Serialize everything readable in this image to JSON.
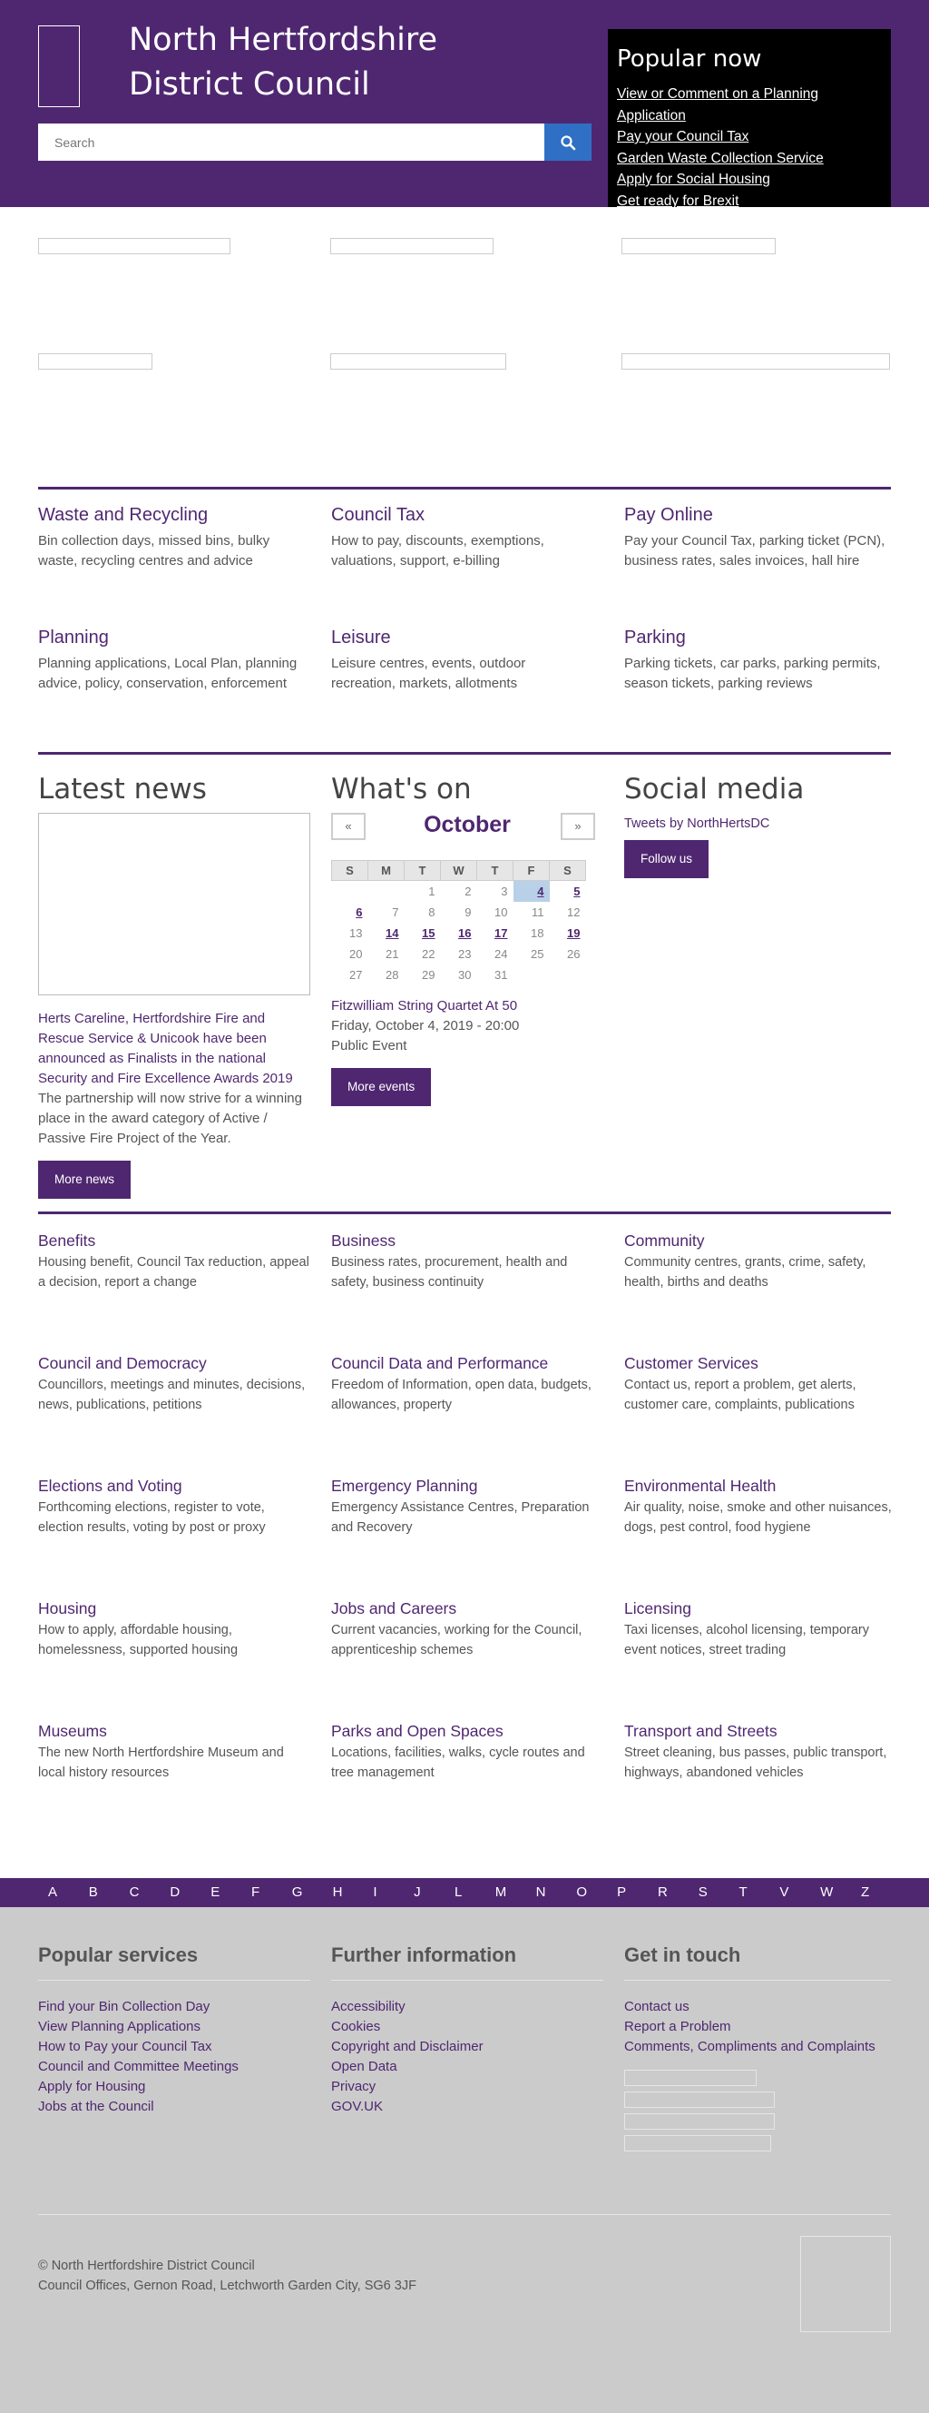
{
  "header": {
    "title_line1": "North Hertfordshire",
    "title_line2": "District Council",
    "search_placeholder": "Search",
    "popular_title": "Popular now",
    "popular_links": [
      "View or Comment on a Planning Application",
      "Pay your Council Tax",
      "Garden Waste Collection Service",
      "Apply for Social Housing",
      "Get ready for Brexit"
    ]
  },
  "top_services": [
    {
      "title": "Waste and Recycling",
      "desc": "Bin collection days, missed bins, bulky waste, recycling centres and advice"
    },
    {
      "title": "Council Tax",
      "desc": "How to pay, discounts, exemptions, valuations, support, e-billing"
    },
    {
      "title": "Pay Online",
      "desc": "Pay your Council Tax, parking ticket (PCN), business rates, sales invoices, hall hire"
    },
    {
      "title": "Planning",
      "desc": "Planning applications, Local Plan, planning advice, policy, conservation, enforcement"
    },
    {
      "title": "Leisure",
      "desc": "Leisure centres, events, outdoor recreation, markets, allotments"
    },
    {
      "title": "Parking",
      "desc": "Parking tickets, car parks, parking permits, season tickets, parking reviews"
    }
  ],
  "news": {
    "heading": "Latest news",
    "headline": "Herts Careline, Hertfordshire Fire and Rescue Service & Unicook have been announced as Finalists in the national Security and Fire Excellence Awards 2019",
    "summary": "The partnership will now strive for a winning place in the award category of Active / Passive Fire Project of the Year.",
    "button": "More news"
  },
  "whats_on": {
    "heading": "What's on",
    "prev": "«",
    "next": "»",
    "month": "October",
    "days": [
      "S",
      "M",
      "T",
      "W",
      "T",
      "F",
      "S"
    ],
    "weeks": [
      [
        "",
        "",
        "1",
        "2",
        "3",
        "4",
        "5"
      ],
      [
        "6",
        "7",
        "8",
        "9",
        "10",
        "11",
        "12"
      ],
      [
        "13",
        "14",
        "15",
        "16",
        "17",
        "18",
        "19"
      ],
      [
        "20",
        "21",
        "22",
        "23",
        "24",
        "25",
        "26"
      ],
      [
        "27",
        "28",
        "29",
        "30",
        "31",
        "",
        ""
      ]
    ],
    "event_days": [
      "4",
      "5",
      "6",
      "14",
      "15",
      "16",
      "17",
      "19"
    ],
    "today": "4",
    "event_title": "Fitzwilliam String Quartet At 50",
    "event_date": "Friday, October 4, 2019 - 20:00",
    "event_type": "Public Event",
    "button": "More events"
  },
  "social": {
    "heading": "Social media",
    "tweets": "Tweets by NorthHertsDC",
    "button": "Follow us"
  },
  "services": [
    {
      "title": "Benefits",
      "desc": "Housing benefit, Council Tax reduction, appeal a decision, report a change"
    },
    {
      "title": "Business",
      "desc": "Business rates, procurement, health and safety, business continuity"
    },
    {
      "title": "Community",
      "desc": "Community centres, grants, crime, safety, health, births and deaths"
    },
    {
      "title": "Council and Democracy",
      "desc": "Councillors, meetings and minutes, decisions, news, publications, petitions"
    },
    {
      "title": "Council Data and Performance",
      "desc": "Freedom of Information, open data, budgets, allowances, property"
    },
    {
      "title": "Customer Services",
      "desc": "Contact us, report a problem, get alerts, customer care, complaints, publications"
    },
    {
      "title": "Elections and Voting",
      "desc": "Forthcoming elections, register to vote, election results, voting by post or proxy"
    },
    {
      "title": "Emergency Planning",
      "desc": "Emergency Assistance Centres, Preparation and Recovery"
    },
    {
      "title": "Environmental Health",
      "desc": "Air quality, noise, smoke and other nuisances, dogs, pest control, food hygiene"
    },
    {
      "title": "Housing",
      "desc": "How to apply, affordable housing, homelessness, supported housing"
    },
    {
      "title": "Jobs and Careers",
      "desc": "Current vacancies, working for the Council, apprenticeship schemes"
    },
    {
      "title": "Licensing",
      "desc": "Taxi licenses, alcohol licensing, temporary event notices, street trading"
    },
    {
      "title": "Museums",
      "desc": "The new North Hertfordshire Museum and local history resources"
    },
    {
      "title": "Parks and Open Spaces",
      "desc": "Locations, facilities, walks, cycle routes and tree management"
    },
    {
      "title": "Transport and Streets",
      "desc": "Street cleaning, bus passes, public transport, highways, abandoned vehicles"
    }
  ],
  "az": [
    "A",
    "B",
    "C",
    "D",
    "E",
    "F",
    "G",
    "H",
    "I",
    "J",
    "L",
    "M",
    "N",
    "O",
    "P",
    "R",
    "S",
    "T",
    "V",
    "W",
    "Z"
  ],
  "footer": {
    "popular_title": "Popular services",
    "popular": [
      "Find your Bin Collection Day",
      "View Planning Applications",
      "How to Pay your Council Tax",
      "Council and Committee Meetings",
      "Apply for Housing",
      "Jobs at the Council"
    ],
    "further_title": "Further information",
    "further": [
      "Accessibility",
      "Cookies",
      "Copyright and Disclaimer",
      "Open Data",
      "Privacy",
      "GOV.UK"
    ],
    "touch_title": "Get in touch",
    "touch": [
      "Contact us",
      "Report a Problem",
      "Comments, Compliments and Complaints"
    ],
    "copyright": "© North Hertfordshire District Council",
    "address": "Council Offices, Gernon Road, Letchworth Garden City, SG6 3JF"
  }
}
